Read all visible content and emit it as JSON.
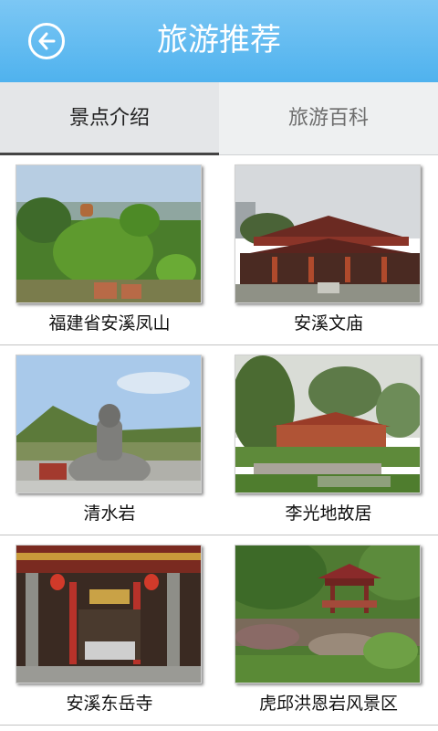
{
  "header": {
    "title": "旅游推荐",
    "back_icon": "back-arrow-icon"
  },
  "tabs": [
    {
      "label": "景点介绍",
      "active": true
    },
    {
      "label": "旅游百科",
      "active": false
    }
  ],
  "attractions": [
    {
      "name": "福建省安溪凤山"
    },
    {
      "name": "安溪文庙"
    },
    {
      "name": "清水岩"
    },
    {
      "name": "李光地故居"
    },
    {
      "name": "安溪东岳寺"
    },
    {
      "name": "虎邱洪恩岩风景区"
    }
  ],
  "colors": {
    "header": "#56b5ef",
    "tab_active": "#e4e6e8",
    "tab_inactive": "#eef0f1"
  }
}
